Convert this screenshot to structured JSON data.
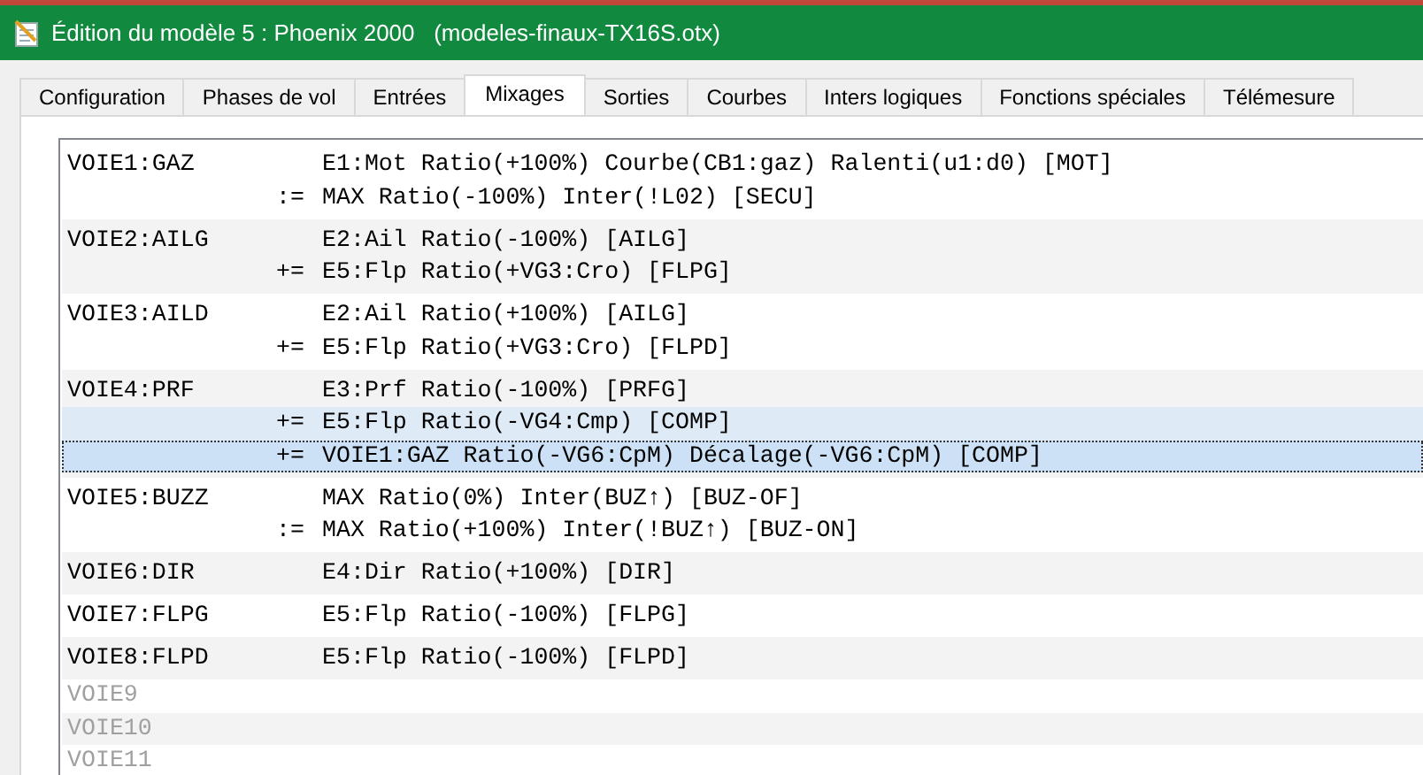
{
  "window": {
    "title": "Édition du modèle 5 : Phoenix 2000   (modeles-finaux-TX16S.otx)"
  },
  "tabs": [
    {
      "label": "Configuration",
      "selected": false
    },
    {
      "label": "Phases de vol",
      "selected": false
    },
    {
      "label": "Entrées",
      "selected": false
    },
    {
      "label": "Mixages",
      "selected": true
    },
    {
      "label": "Sorties",
      "selected": false
    },
    {
      "label": "Courbes",
      "selected": false
    },
    {
      "label": "Inters logiques",
      "selected": false
    },
    {
      "label": "Fonctions spéciales",
      "selected": false
    },
    {
      "label": "Télémesure",
      "selected": false
    }
  ],
  "channels": [
    {
      "name": "VOIE1:GAZ",
      "empty": false,
      "mixes": [
        {
          "text": "E1:Mot Ratio(+100%) Courbe(CB1:gaz) Ralenti(u1:d0) [MOT]",
          "selected": false,
          "focused": false
        },
        {
          "op": ":=",
          "text": "MAX Ratio(-100%) Inter(!L02) [SECU]",
          "selected": false,
          "focused": false
        }
      ]
    },
    {
      "name": "VOIE2:AILG",
      "empty": false,
      "mixes": [
        {
          "text": "E2:Ail Ratio(-100%) [AILG]",
          "selected": false,
          "focused": false
        },
        {
          "op": "+=",
          "text": "E5:Flp Ratio(+VG3:Cro) [FLPG]",
          "selected": false,
          "focused": false
        }
      ]
    },
    {
      "name": "VOIE3:AILD",
      "empty": false,
      "mixes": [
        {
          "text": "E2:Ail Ratio(+100%) [AILG]",
          "selected": false,
          "focused": false
        },
        {
          "op": "+=",
          "text": "E5:Flp Ratio(+VG3:Cro) [FLPD]",
          "selected": false,
          "focused": false
        }
      ]
    },
    {
      "name": "VOIE4:PRF",
      "empty": false,
      "mixes": [
        {
          "text": "E3:Prf Ratio(-100%) [PRFG]",
          "selected": false,
          "focused": false
        },
        {
          "op": "+=",
          "text": "E5:Flp Ratio(-VG4:Cmp) [COMP]",
          "selected": true,
          "focused": false
        },
        {
          "op": "+=",
          "text": "VOIE1:GAZ Ratio(-VG6:CpM) Décalage(-VG6:CpM) [COMP]",
          "selected": true,
          "focused": true
        }
      ]
    },
    {
      "name": "VOIE5:BUZZ",
      "empty": false,
      "mixes": [
        {
          "text": "MAX Ratio(0%) Inter(BUZ↑) [BUZ-OF]",
          "selected": false,
          "focused": false
        },
        {
          "op": ":=",
          "text": "MAX Ratio(+100%) Inter(!BUZ↑) [BUZ-ON]",
          "selected": false,
          "focused": false
        }
      ]
    },
    {
      "name": "VOIE6:DIR",
      "empty": false,
      "mixes": [
        {
          "text": "E4:Dir Ratio(+100%) [DIR]",
          "selected": false,
          "focused": false
        }
      ]
    },
    {
      "name": "VOIE7:FLPG",
      "empty": false,
      "mixes": [
        {
          "text": "E5:Flp Ratio(-100%) [FLPG]",
          "selected": false,
          "focused": false
        }
      ]
    },
    {
      "name": "VOIE8:FLPD",
      "empty": false,
      "mixes": [
        {
          "text": "E5:Flp Ratio(-100%) [FLPD]",
          "selected": false,
          "focused": false
        }
      ]
    },
    {
      "name": "VOIE9",
      "empty": true
    },
    {
      "name": "VOIE10",
      "empty": true
    },
    {
      "name": "VOIE11",
      "empty": true
    }
  ]
}
